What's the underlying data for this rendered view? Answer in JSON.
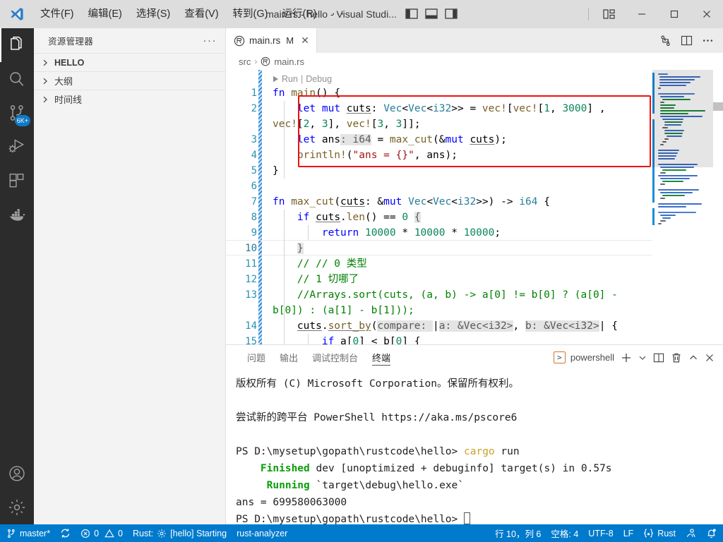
{
  "window": {
    "title": "main.rs - hello - Visual Studi...",
    "menu": [
      {
        "label": "文件(F)",
        "mnemonic": "F"
      },
      {
        "label": "编辑(E)",
        "mnemonic": "E"
      },
      {
        "label": "选择(S)",
        "mnemonic": "S"
      },
      {
        "label": "查看(V)",
        "mnemonic": "V"
      },
      {
        "label": "转到(G)",
        "mnemonic": "G"
      },
      {
        "label": "运行(R)",
        "mnemonic": "R"
      }
    ],
    "more_label": "···",
    "controls": {
      "minimize": "─",
      "maximize": "☐",
      "close": "✕"
    },
    "layout_icons": [
      "toggle-primary-sidebar-icon",
      "toggle-panel-icon",
      "toggle-secondary-sidebar-icon",
      "customize-layout-icon"
    ]
  },
  "activitybar": {
    "items": [
      {
        "name": "explorer",
        "icon": "files-icon",
        "active": true,
        "badge": ""
      },
      {
        "name": "search",
        "icon": "search-icon",
        "active": false,
        "badge": ""
      },
      {
        "name": "source-control",
        "icon": "source-control-icon",
        "active": false,
        "badge": "6K+"
      },
      {
        "name": "run-and-debug",
        "icon": "run-debug-icon",
        "active": false,
        "badge": ""
      },
      {
        "name": "extensions",
        "icon": "extensions-icon",
        "active": false,
        "badge": ""
      },
      {
        "name": "docker",
        "icon": "docker-icon",
        "active": false,
        "badge": ""
      }
    ],
    "bottom": [
      {
        "name": "accounts",
        "icon": "account-icon"
      },
      {
        "name": "settings",
        "icon": "gear-icon"
      }
    ]
  },
  "sidebar": {
    "title": "资源管理器",
    "more_label": "···",
    "sections": [
      {
        "label": "HELLO",
        "expanded": false,
        "bold": true
      },
      {
        "label": "大纲",
        "expanded": false,
        "bold": false
      },
      {
        "label": "时间线",
        "expanded": false,
        "bold": false
      }
    ]
  },
  "editor": {
    "tab": {
      "filename": "main.rs",
      "dirty_indicator": "M",
      "close_label": "✕",
      "icon": "rust-file-icon"
    },
    "tab_actions": [
      "split-changes-icon",
      "split-editor-icon",
      "more-actions-icon"
    ],
    "breadcrumb": {
      "parts": [
        "src",
        "main.rs"
      ],
      "separator": "›",
      "icon": "rust-file-icon"
    },
    "codelens": {
      "run": "Run",
      "separator": "|",
      "debug": "Debug",
      "play_icon": "play-icon"
    },
    "line_numbers": [
      "1",
      "2",
      "3",
      "4",
      "5",
      "6",
      "7",
      "8",
      "9",
      "10",
      "11",
      "12",
      "13",
      "14",
      "15"
    ],
    "code_lines": [
      {
        "n": "1",
        "text": "fn main() {"
      },
      {
        "n": "2",
        "text": "    let mut cuts: Vec<Vec<i32>> = vec![vec![1, 3000] ,"
      },
      {
        "n": "",
        "text": "vec![2, 3], vec![3, 3]];"
      },
      {
        "n": "3",
        "text": "    let ans: i64 = max_cut(&mut cuts);"
      },
      {
        "n": "4",
        "text": "    println!(\"ans = {}\", ans);"
      },
      {
        "n": "5",
        "text": "}"
      },
      {
        "n": "6",
        "text": ""
      },
      {
        "n": "7",
        "text": "fn max_cut(cuts: &mut Vec<Vec<i32>>) -> i64 {"
      },
      {
        "n": "8",
        "text": "    if cuts.len() == 0 {"
      },
      {
        "n": "9",
        "text": "        return 10000 * 10000 * 10000;"
      },
      {
        "n": "10",
        "text": "    }"
      },
      {
        "n": "11",
        "text": "    // // 0 类型"
      },
      {
        "n": "12",
        "text": "    // 1 切哪了"
      },
      {
        "n": "13",
        "text": "    //Arrays.sort(cuts, (a, b) -> a[0] != b[0] ? (a[0] - b[0]) : (a[1] - b[1]));"
      },
      {
        "n": "14",
        "text": "    cuts.sort_by(compare: |a: &Vec<i32>, b: &Vec<i32>| {"
      },
      {
        "n": "15",
        "text": "        if a[0] < b[0] {"
      }
    ],
    "inlay_hints": [
      "compare:",
      "a:",
      "b:",
      "i64"
    ],
    "highlight_box": {
      "color": "#ee1111",
      "label": "red-annotation-box"
    }
  },
  "panel": {
    "tabs": [
      {
        "label": "问题",
        "active": false
      },
      {
        "label": "输出",
        "active": false
      },
      {
        "label": "调试控制台",
        "active": false
      },
      {
        "label": "终端",
        "active": true
      }
    ],
    "shell": {
      "name": "powershell",
      "icon": "terminal-powershell-icon"
    },
    "actions": [
      {
        "name": "new-terminal",
        "glyph": "+"
      },
      {
        "name": "terminal-dropdown",
        "glyph": "⌄"
      },
      {
        "name": "split-terminal",
        "glyph": "split"
      },
      {
        "name": "kill-terminal",
        "glyph": "trash"
      },
      {
        "name": "maximize-panel",
        "glyph": "⌃"
      },
      {
        "name": "close-panel",
        "glyph": "✕"
      }
    ],
    "terminal_lines": [
      {
        "segments": [
          {
            "t": "版权所有 (C) Microsoft Corporation。保留所有权利。",
            "c": "plain"
          }
        ]
      },
      {
        "segments": [
          {
            "t": "",
            "c": "plain"
          }
        ]
      },
      {
        "segments": [
          {
            "t": "尝试新的跨平台 PowerShell https://aka.ms/pscore6",
            "c": "plain"
          }
        ]
      },
      {
        "segments": [
          {
            "t": "",
            "c": "plain"
          }
        ]
      },
      {
        "segments": [
          {
            "t": "PS D:\\mysetup\\gopath\\rustcode\\hello> ",
            "c": "plain"
          },
          {
            "t": "cargo",
            "c": "yellow"
          },
          {
            "t": " run",
            "c": "plain"
          }
        ]
      },
      {
        "segments": [
          {
            "t": "    ",
            "c": "plain"
          },
          {
            "t": "Finished",
            "c": "green"
          },
          {
            "t": " dev [unoptimized + debuginfo] target(s) in 0.57s",
            "c": "plain"
          }
        ]
      },
      {
        "segments": [
          {
            "t": "     ",
            "c": "plain"
          },
          {
            "t": "Running",
            "c": "green"
          },
          {
            "t": " `target\\debug\\hello.exe`",
            "c": "plain"
          }
        ]
      },
      {
        "segments": [
          {
            "t": "ans = 699580063000",
            "c": "plain"
          }
        ]
      },
      {
        "segments": [
          {
            "t": "PS D:\\mysetup\\gopath\\rustcode\\hello> ",
            "c": "plain"
          },
          {
            "t": "█",
            "c": "cursor"
          }
        ]
      }
    ]
  },
  "statusbar": {
    "background": "#007acc",
    "left": [
      {
        "name": "branch",
        "icon": "source-control-icon",
        "label": "master*"
      },
      {
        "name": "sync",
        "icon": "sync-icon",
        "label": ""
      },
      {
        "name": "problems",
        "icon": "error-warning-icon",
        "label": "0",
        "label2": "0"
      },
      {
        "name": "rust-status",
        "icon": "gear-icon",
        "label_pre": "Rust:",
        "label": "[hello] Starting"
      },
      {
        "name": "rust-analyzer",
        "icon": "",
        "label": "rust-analyzer"
      }
    ],
    "right": [
      {
        "name": "cursor-position",
        "label": "行 10，列 6"
      },
      {
        "name": "indentation",
        "label": "空格: 4"
      },
      {
        "name": "encoding",
        "label": "UTF-8"
      },
      {
        "name": "eol",
        "label": "LF"
      },
      {
        "name": "language-mode",
        "icon": "rust-icon",
        "label": "Rust"
      },
      {
        "name": "remote-window",
        "icon": "broadcast-icon",
        "label": ""
      },
      {
        "name": "notifications",
        "icon": "bell-dot-icon",
        "label": ""
      }
    ]
  },
  "colors": {
    "accent": "#007acc",
    "titlebar_bg": "#dddddd",
    "activitybar_bg": "#2c2c2c",
    "sidebar_bg": "#f3f3f3",
    "editor_bg": "#ffffff",
    "annotation_red": "#ee1111",
    "badge_blue": "#0e79c6"
  }
}
